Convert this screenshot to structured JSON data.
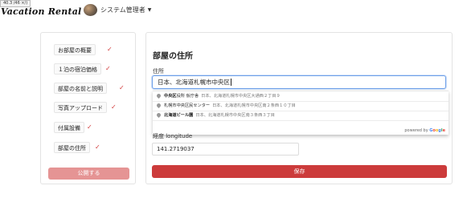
{
  "header": {
    "size_badge": "40.3 /46 ×/)",
    "logo": "Vacation Rental",
    "user_name": "システム管理者"
  },
  "steps": [
    {
      "label": "お部屋の概要",
      "done": true
    },
    {
      "label": "１泊の宿泊価格",
      "done": true
    },
    {
      "label": "部屋の名前と説明",
      "done": true
    },
    {
      "label": "写真アップロード",
      "done": true
    },
    {
      "label": "付属設備",
      "done": true
    },
    {
      "label": "部屋の住所",
      "done": true
    }
  ],
  "publish_label": "公開する",
  "main": {
    "title": "部屋の住所",
    "address_label": "住所",
    "address_value": "日本、北海道札幌市中央区",
    "suggestions": [
      {
        "bold": "中央区",
        "main_rest": "役所 仮庁舎",
        "secondary": "日本、北海道札幌市中央区大通西２丁目９"
      },
      {
        "bold": "",
        "main_rest": "札幌市中央区民センター",
        "secondary": "日本、北海道札幌市中央区南２条西１０丁目"
      },
      {
        "bold": "北海道ビール園",
        "main_rest": "",
        "secondary": "日本、北海道札幌市中央区南３条西３丁目"
      }
    ],
    "powered_by": "powered by",
    "google": "Google",
    "longitude_label": "経度 longitude",
    "longitude_value": "141.2719037",
    "save_label": "保存"
  },
  "colors": {
    "accent": "#cc3b3b",
    "accent_light": "#e59494",
    "check": "#d23a3a"
  }
}
